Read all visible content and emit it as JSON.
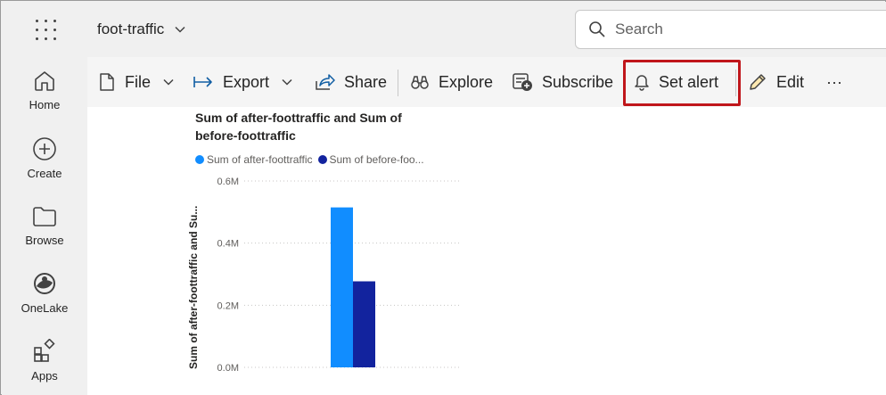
{
  "header": {
    "workspace_name": "foot-traffic",
    "search_placeholder": "Search"
  },
  "nav": {
    "items": [
      {
        "label": "Home",
        "icon": "home-icon"
      },
      {
        "label": "Create",
        "icon": "plus-circle-icon"
      },
      {
        "label": "Browse",
        "icon": "folder-icon"
      },
      {
        "label": "OneLake",
        "icon": "onelake-icon"
      },
      {
        "label": "Apps",
        "icon": "apps-icon"
      }
    ]
  },
  "toolbar": {
    "file": "File",
    "export": "Export",
    "share": "Share",
    "explore": "Explore",
    "subscribe": "Subscribe",
    "set_alert": "Set alert",
    "edit": "Edit",
    "more": "···"
  },
  "colors": {
    "highlight": "#c0161b",
    "series_after": "#118dff",
    "series_before": "#12239e"
  },
  "chart_data": {
    "type": "bar",
    "title": "Sum of after-foottraffic and Sum of before-foottraffic",
    "title_lines": [
      "Sum of after-foottraffic and Sum of",
      "before-foottraffic"
    ],
    "legend_labels": [
      "Sum of after-foottraffic",
      "Sum of before-foo..."
    ],
    "ylabel": "Sum of after-foottraffic and Su...",
    "yticks": [
      "0.6M",
      "0.4M",
      "0.2M",
      "0.0M"
    ],
    "ylim": [
      0,
      600000
    ],
    "categories": [
      ""
    ],
    "series": [
      {
        "name": "Sum of after-foottraffic",
        "values": [
          515000
        ]
      },
      {
        "name": "Sum of before-foottraffic",
        "values": [
          277000
        ]
      }
    ]
  }
}
